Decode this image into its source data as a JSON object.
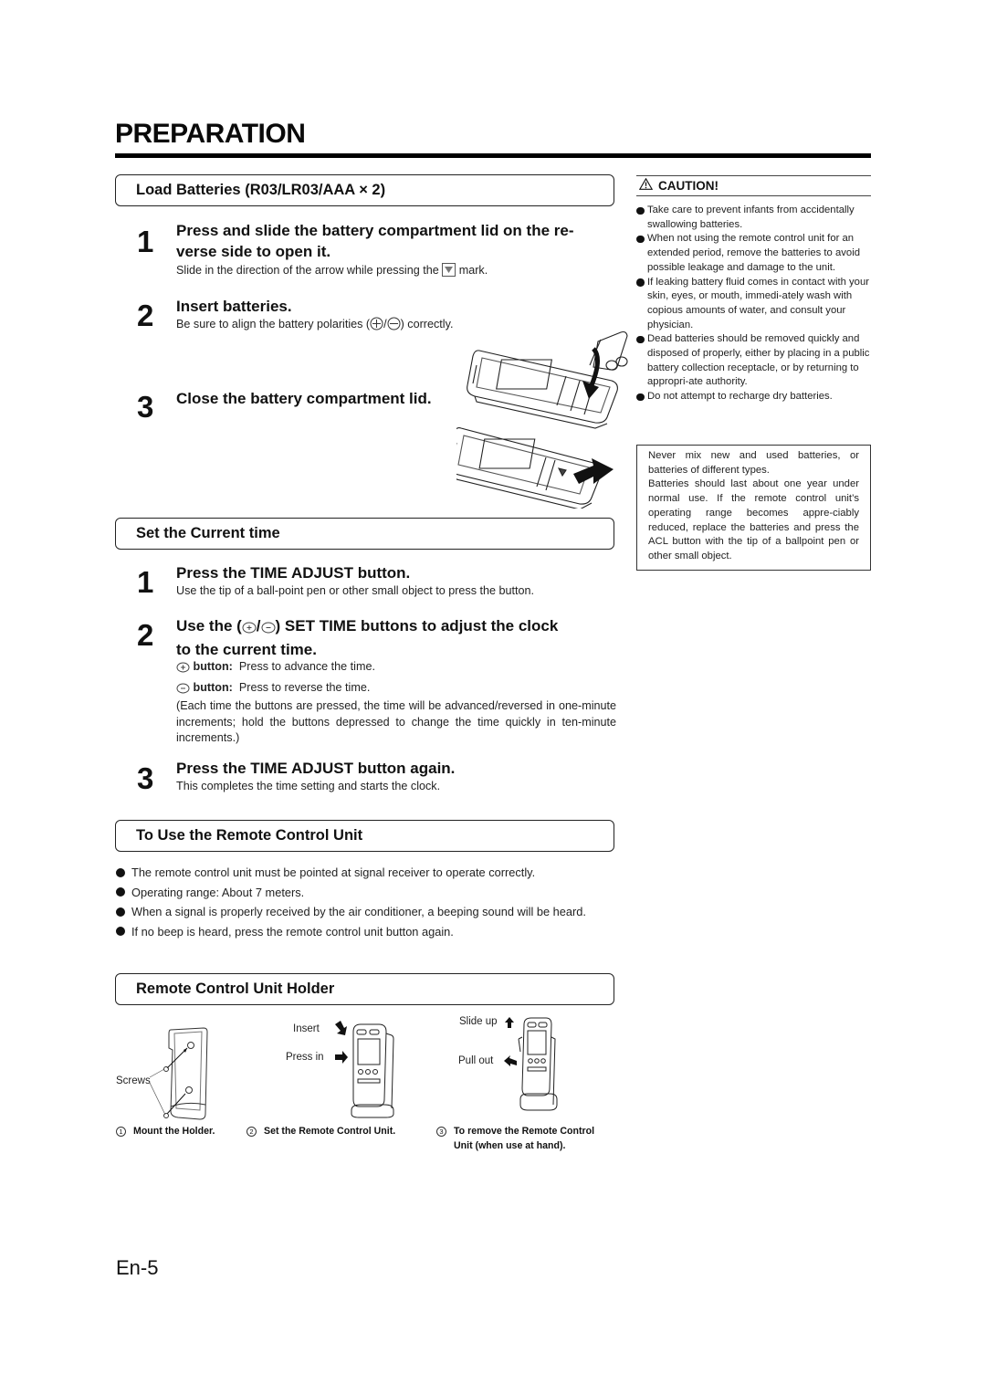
{
  "page": {
    "title": "PREPARATION",
    "page_number": "En-5"
  },
  "load_batteries": {
    "section_title": "Load Batteries (R03/LR03/AAA × 2)",
    "steps": [
      {
        "number": "1",
        "heading_line1": "Press and slide the battery compartment lid on the re-",
        "heading_line2": "verse side to open it.",
        "body_before_icon": "Slide in the direction of the arrow while pressing the",
        "body_after_icon": "mark."
      },
      {
        "number": "2",
        "heading": "Insert batteries.",
        "body_before_icon": "Be sure to align the battery polarities (",
        "body_after_icon": ") correctly."
      },
      {
        "number": "3",
        "heading": "Close the battery compartment lid."
      }
    ]
  },
  "caution": {
    "title": "CAUTION!",
    "items": [
      "Take care to prevent infants from accidentally swallowing batteries.",
      "When not using the remote control unit for an extended period, remove the batteries to avoid possible leakage and damage to the unit.",
      "If leaking battery fluid comes in contact with your skin, eyes, or mouth, immedi-ately wash with copious amounts of water, and consult your physician.",
      "Dead batteries should be removed quickly and disposed of properly, either by placing in a public battery collection receptacle, or by returning to appropri-ate authority.",
      "Do not attempt to recharge dry batteries."
    ],
    "note_paragraphs": [
      "Never mix new and used batteries, or batteries of different types.",
      "Batteries should last about one year under normal use. If the remote control unit’s operating range becomes appre-ciably reduced, replace the batteries and press the ACL button with the tip of a ballpoint pen or other small object."
    ]
  },
  "set_time": {
    "section_title": "Set the Current time",
    "steps": [
      {
        "number": "1",
        "heading": "Press the TIME ADJUST button.",
        "body": "Use the tip of a ball-point pen or other small object to press the button."
      },
      {
        "number": "2",
        "heading_prefix": "Use the (",
        "heading_suffix": ") SET TIME buttons to adjust the clock",
        "heading_line2": "to the current time.",
        "plus_label": "button:",
        "plus_text": "Press to advance the time.",
        "minus_label": "button:",
        "minus_text": "Press to reverse the time.",
        "note": "(Each time the buttons are pressed, the time will be advanced/reversed in one-minute increments; hold the buttons depressed to change the time quickly in ten-minute increments.)"
      },
      {
        "number": "3",
        "heading": "Press the TIME ADJUST button again.",
        "body": "This completes the time setting and starts the clock."
      }
    ]
  },
  "use_remote": {
    "section_title": "To Use the Remote Control Unit",
    "items": [
      "The remote control unit must be pointed at signal receiver to operate correctly.",
      "Operating range: About 7 meters.",
      "When a signal is properly received by the air conditioner, a beeping sound will be heard.",
      "If no beep is heard, press the remote control unit button again."
    ]
  },
  "holder": {
    "section_title": "Remote Control Unit Holder",
    "figure_labels": {
      "screws": "Screws",
      "insert": "Insert",
      "press_in": "Press in",
      "slide_up": "Slide up",
      "pull_out": "Pull out"
    },
    "captions": [
      {
        "marker": "1",
        "text": "Mount the Holder."
      },
      {
        "marker": "2",
        "text": "Set the Remote Control Unit."
      },
      {
        "marker": "3",
        "text": "To remove the Remote Control Unit (when use at hand)."
      }
    ]
  }
}
